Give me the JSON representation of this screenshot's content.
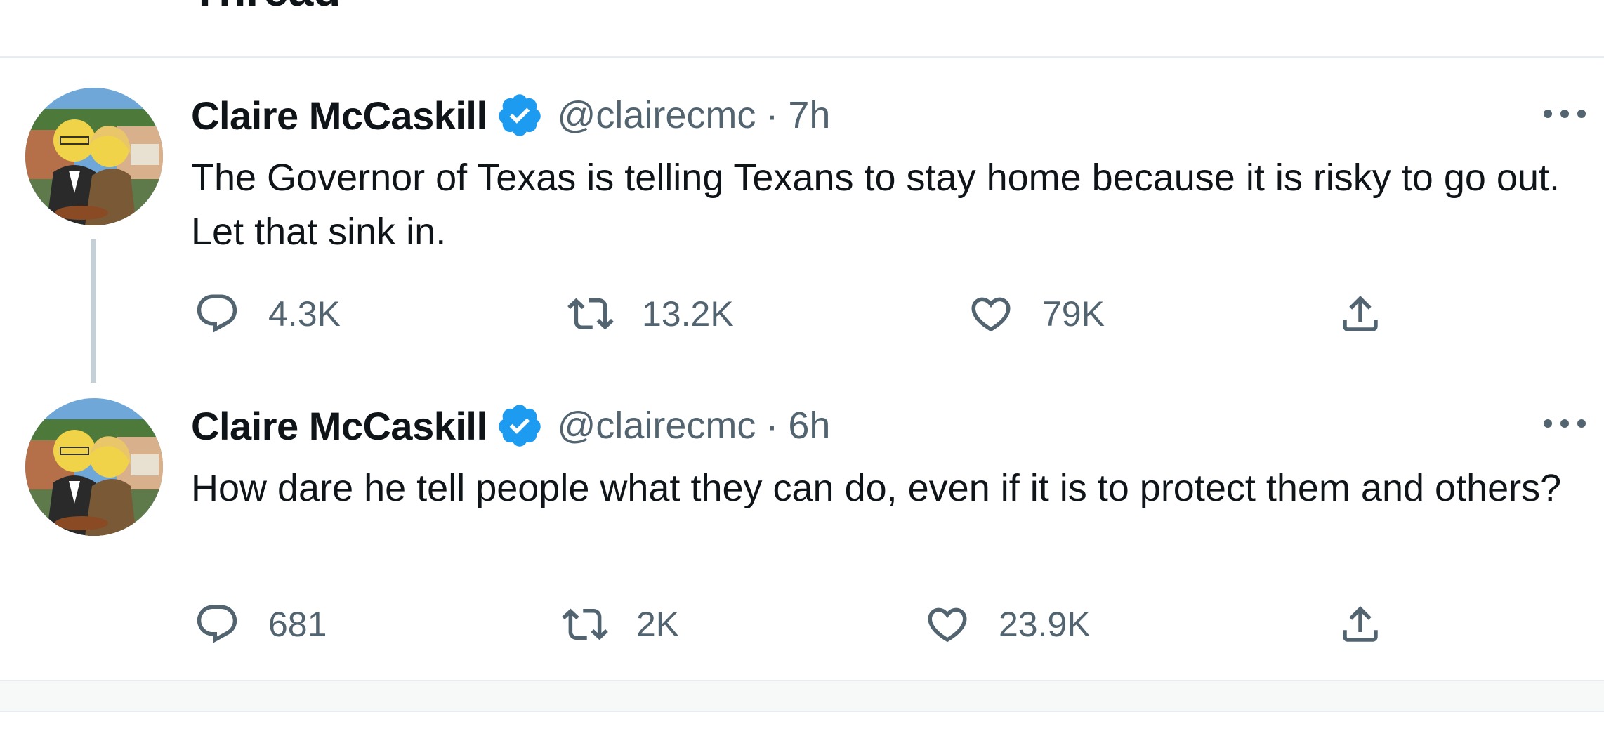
{
  "header": {
    "title": "Thread",
    "back_icon": "arrow-left-icon"
  },
  "tweets": [
    {
      "author_name": "Claire McCaskill",
      "verified_icon": "verified-badge-icon",
      "handle": "@clairecmc",
      "separator": "·",
      "time": "7h",
      "text": "The Governor of Texas is telling Texans to stay home because it is risky to go out. Let that sink in.",
      "replies": "4.3K",
      "retweets": "13.2K",
      "likes": "79K"
    },
    {
      "author_name": "Claire McCaskill",
      "verified_icon": "verified-badge-icon",
      "handle": "@clairecmc",
      "separator": "·",
      "time": "6h",
      "text": "How dare he tell people what they can do, even if it is to protect them and others?",
      "replies": "681",
      "retweets": "2K",
      "likes": "23.9K"
    }
  ],
  "colors": {
    "text_primary": "#0f1419",
    "text_secondary": "#536471",
    "verified_blue": "#1d9bf0",
    "thread_line": "#c4cfd6",
    "divider": "#e6ecf0"
  }
}
